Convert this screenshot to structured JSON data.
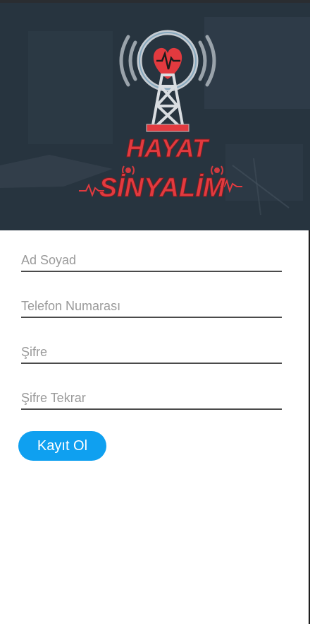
{
  "logo": {
    "line1": "HAYAT",
    "line2": "SİNYALİM"
  },
  "form": {
    "fields": [
      {
        "placeholder": "Ad Soyad",
        "value": ""
      },
      {
        "placeholder": "Telefon Numarası",
        "value": ""
      },
      {
        "placeholder": "Şifre",
        "value": ""
      },
      {
        "placeholder": "Şifre Tekrar",
        "value": ""
      }
    ],
    "submit_label": "Kayıt Ol"
  },
  "colors": {
    "accent": "#0fa0f0",
    "logo_red": "#e23a3f",
    "header_bg": "#2a3744"
  }
}
